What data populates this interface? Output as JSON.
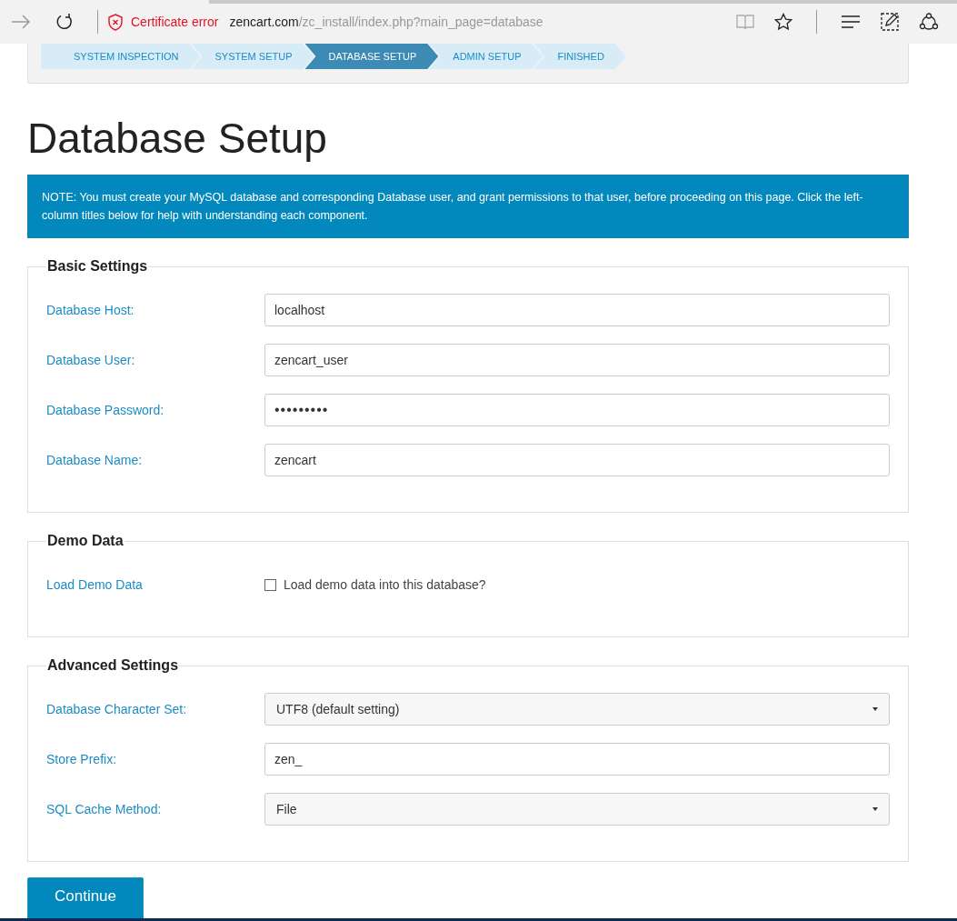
{
  "browser": {
    "certificate_warning": "Certificate error",
    "url_host": "zencart.com",
    "url_path": "/zc_install/index.php?main_page=database"
  },
  "steps": [
    {
      "label": "SYSTEM INSPECTION",
      "selected": false
    },
    {
      "label": "SYSTEM SETUP",
      "selected": false
    },
    {
      "label": "DATABASE SETUP",
      "selected": true
    },
    {
      "label": "ADMIN SETUP",
      "selected": false
    },
    {
      "label": "FINISHED",
      "selected": false
    }
  ],
  "heading": "Database Setup",
  "note": "NOTE: You must create your MySQL database and corresponding Database user, and grant permissions to that user, before proceeding on this page. Click the left-column titles below for help with understanding each component.",
  "sections": [
    {
      "legend": "Basic Settings",
      "rows": [
        {
          "kind": "text",
          "label": "Database Host:",
          "value": "localhost"
        },
        {
          "kind": "text",
          "label": "Database User:",
          "value": "zencart_user"
        },
        {
          "kind": "password",
          "label": "Database Password:",
          "value": "•••••••••"
        },
        {
          "kind": "text",
          "label": "Database Name:",
          "value": "zencart"
        }
      ]
    },
    {
      "legend": "Demo Data",
      "rows": [
        {
          "kind": "checkbox",
          "label": "Load Demo Data",
          "value": "Load demo data into this database?",
          "checked": false
        }
      ]
    },
    {
      "legend": "Advanced Settings",
      "rows": [
        {
          "kind": "select",
          "label": "Database Character Set:",
          "value": "UTF8 (default setting)"
        },
        {
          "kind": "text",
          "label": "Store Prefix:",
          "value": "zen_"
        },
        {
          "kind": "select",
          "label": "SQL Cache Method:",
          "value": "File"
        }
      ]
    }
  ],
  "continue_button": "Continue"
}
